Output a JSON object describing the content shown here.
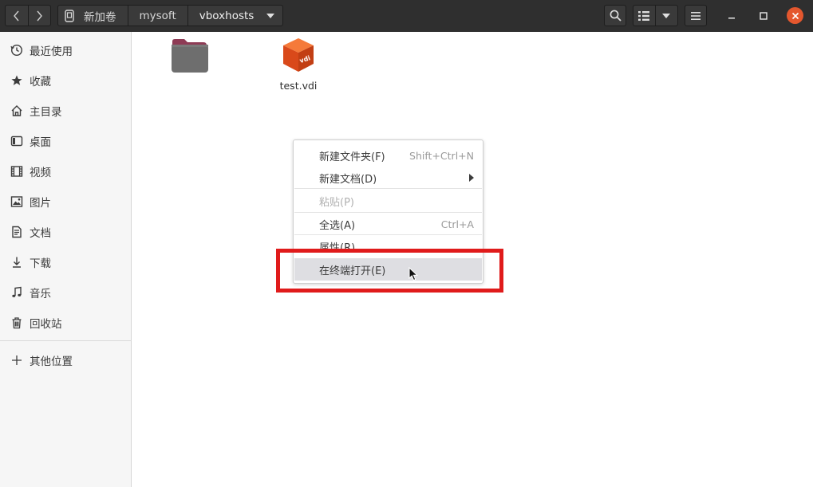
{
  "window": {
    "breadcrumbs": [
      "新加卷",
      "mysoft",
      "vboxhosts"
    ],
    "icons": {
      "back": "chevron-left-icon",
      "forward": "chevron-right-icon",
      "drive": "drive-icon",
      "search": "search-icon",
      "view": "list-view-icon",
      "view_dropdown": "chevron-down-icon",
      "menu": "hamburger-icon",
      "minimize": "minimize-icon",
      "maximize": "maximize-icon",
      "close": "close-icon"
    },
    "close_color": "#e4572e"
  },
  "sidebar": {
    "items": [
      {
        "label": "最近使用",
        "icon": "clock-icon"
      },
      {
        "label": "收藏",
        "icon": "star-icon"
      },
      {
        "label": "主目录",
        "icon": "home-icon"
      },
      {
        "label": "桌面",
        "icon": "desktop-icon"
      },
      {
        "label": "视频",
        "icon": "video-icon"
      },
      {
        "label": "图片",
        "icon": "image-icon"
      },
      {
        "label": "文档",
        "icon": "document-icon"
      },
      {
        "label": "下载",
        "icon": "download-icon"
      },
      {
        "label": "音乐",
        "icon": "music-icon"
      },
      {
        "label": "回收站",
        "icon": "trash-icon"
      }
    ],
    "other": {
      "label": "其他位置",
      "icon": "plus-icon"
    }
  },
  "files": [
    {
      "label": "",
      "icon": "folder-icon"
    },
    {
      "label": "test.vdi",
      "icon": "vdi-file-icon",
      "badge": "vdi"
    }
  ],
  "context_menu": {
    "items": [
      {
        "label": "新建文件夹(F)",
        "accel": "Shift+Ctrl+N"
      },
      {
        "label": "新建文档(D)",
        "accel": "",
        "submenu": true
      },
      {
        "label": "粘贴(P)",
        "accel": "",
        "disabled": true
      },
      {
        "label": "全选(A)",
        "accel": "Ctrl+A"
      },
      {
        "label": "属性(R)",
        "accel": ""
      },
      {
        "label": "在终端打开(E)",
        "accel": "",
        "hovered": true
      }
    ]
  },
  "colors": {
    "header": "#2f2f2f",
    "highlight": "#e01b1b",
    "folder": "#6e6e6e",
    "vdi": "#e85a1f"
  }
}
